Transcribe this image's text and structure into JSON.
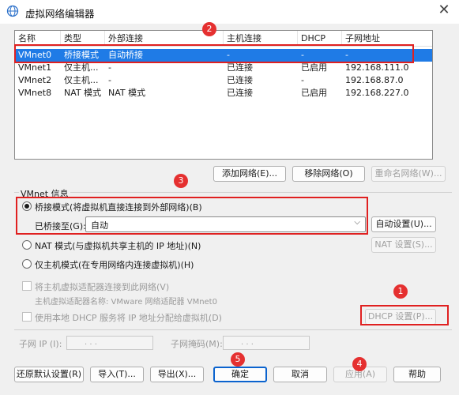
{
  "window": {
    "title": "虚拟网络编辑器",
    "close_glyph": "✕"
  },
  "table": {
    "headers": [
      "名称",
      "类型",
      "外部连接",
      "主机连接",
      "DHCP",
      "子网地址"
    ],
    "rows": [
      [
        "VMnet0",
        "桥接模式",
        "自动桥接",
        "-",
        "-",
        "-"
      ],
      [
        "VMnet1",
        "仅主机...",
        "-",
        "已连接",
        "已启用",
        "192.168.111.0"
      ],
      [
        "VMnet2",
        "仅主机...",
        "-",
        "已连接",
        "-",
        "192.168.87.0"
      ],
      [
        "VMnet8",
        "NAT 模式",
        "NAT 模式",
        "已连接",
        "已启用",
        "192.168.227.0"
      ]
    ]
  },
  "table_buttons": {
    "add": "添加网络(E)...",
    "remove": "移除网络(O)",
    "rename": "重命名网络(W)..."
  },
  "vmnet_info": {
    "title": "VMnet 信息",
    "bridged_label": "桥接模式(将虚拟机直接连接到外部网络)(B)",
    "bridged_to_label": "已桥接至(G):",
    "bridged_to_value": "自动",
    "auto_settings": "自动设置(U)...",
    "nat_label": "NAT 模式(与虚拟机共享主机的 IP 地址)(N)",
    "nat_settings": "NAT 设置(S)...",
    "hostonly_label": "仅主机模式(在专用网络内连接虚拟机)(H)",
    "connect_adapter_label": "将主机虚拟适配器连接到此网络(V)",
    "adapter_name_label": "主机虚拟适配器名称: VMware 网络适配器 VMnet0",
    "dhcp_label": "使用本地 DHCP 服务将 IP 地址分配给虚拟机(D)",
    "dhcp_settings": "DHCP 设置(P)...",
    "subnet_ip_label": "子网 IP (I):",
    "subnet_mask_label": "子网掩码(M):",
    "ip_placeholder": ".     .     ."
  },
  "footer": {
    "restore": "还原默认设置(R)",
    "import": "导入(T)...",
    "export": "导出(X)...",
    "ok": "确定",
    "cancel": "取消",
    "apply": "应用(A)",
    "help": "帮助"
  },
  "annotations": [
    "1",
    "2",
    "3",
    "4",
    "5"
  ],
  "colors": {
    "annotation": "#e02020",
    "selection": "#1f7be6",
    "default_button_border": "#0b63ce"
  }
}
